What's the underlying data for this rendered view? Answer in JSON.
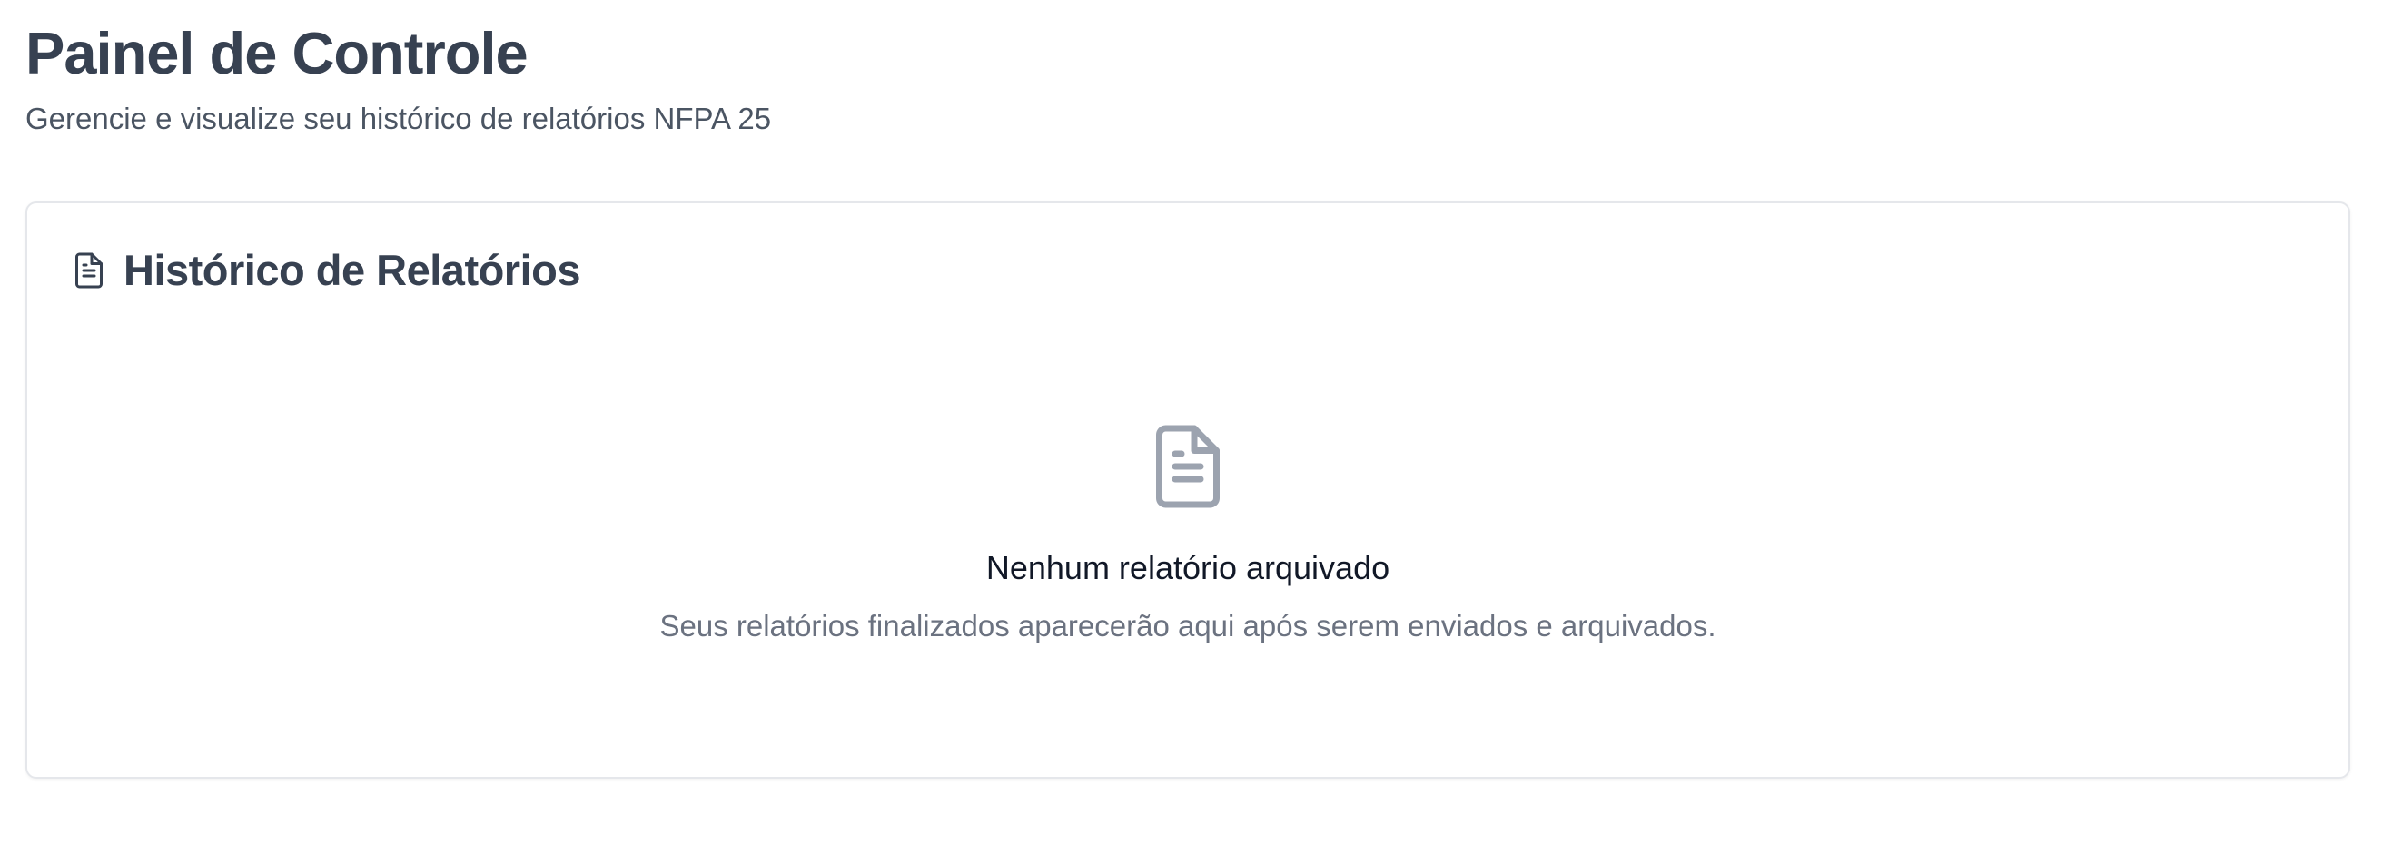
{
  "header": {
    "title": "Painel de Controle",
    "subtitle": "Gerencie e visualize seu histórico de relatórios NFPA 25"
  },
  "reports_card": {
    "icon": "file-text-icon",
    "title": "Histórico de Relatórios",
    "empty_state": {
      "icon": "file-text-icon",
      "title": "Nenhum relatório arquivado",
      "description": "Seus relatórios finalizados aparecerão aqui após serem enviados e arquivados."
    }
  },
  "colors": {
    "heading": "#374151",
    "muted": "#6b7280",
    "icon_muted": "#9ca3af",
    "border": "#e5e7eb"
  }
}
